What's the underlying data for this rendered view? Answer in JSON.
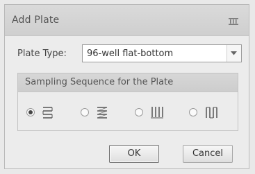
{
  "dialog": {
    "title": "Add Plate",
    "plate_type": {
      "label": "Plate Type:",
      "selected": "96-well flat-bottom"
    },
    "sampling": {
      "title": "Sampling Sequence for the Plate",
      "options": [
        {
          "name": "row-serpentine",
          "selected": true
        },
        {
          "name": "row-raster",
          "selected": false
        },
        {
          "name": "column-raster",
          "selected": false
        },
        {
          "name": "column-serpentine",
          "selected": false
        }
      ]
    },
    "buttons": {
      "ok": "OK",
      "cancel": "Cancel"
    }
  }
}
